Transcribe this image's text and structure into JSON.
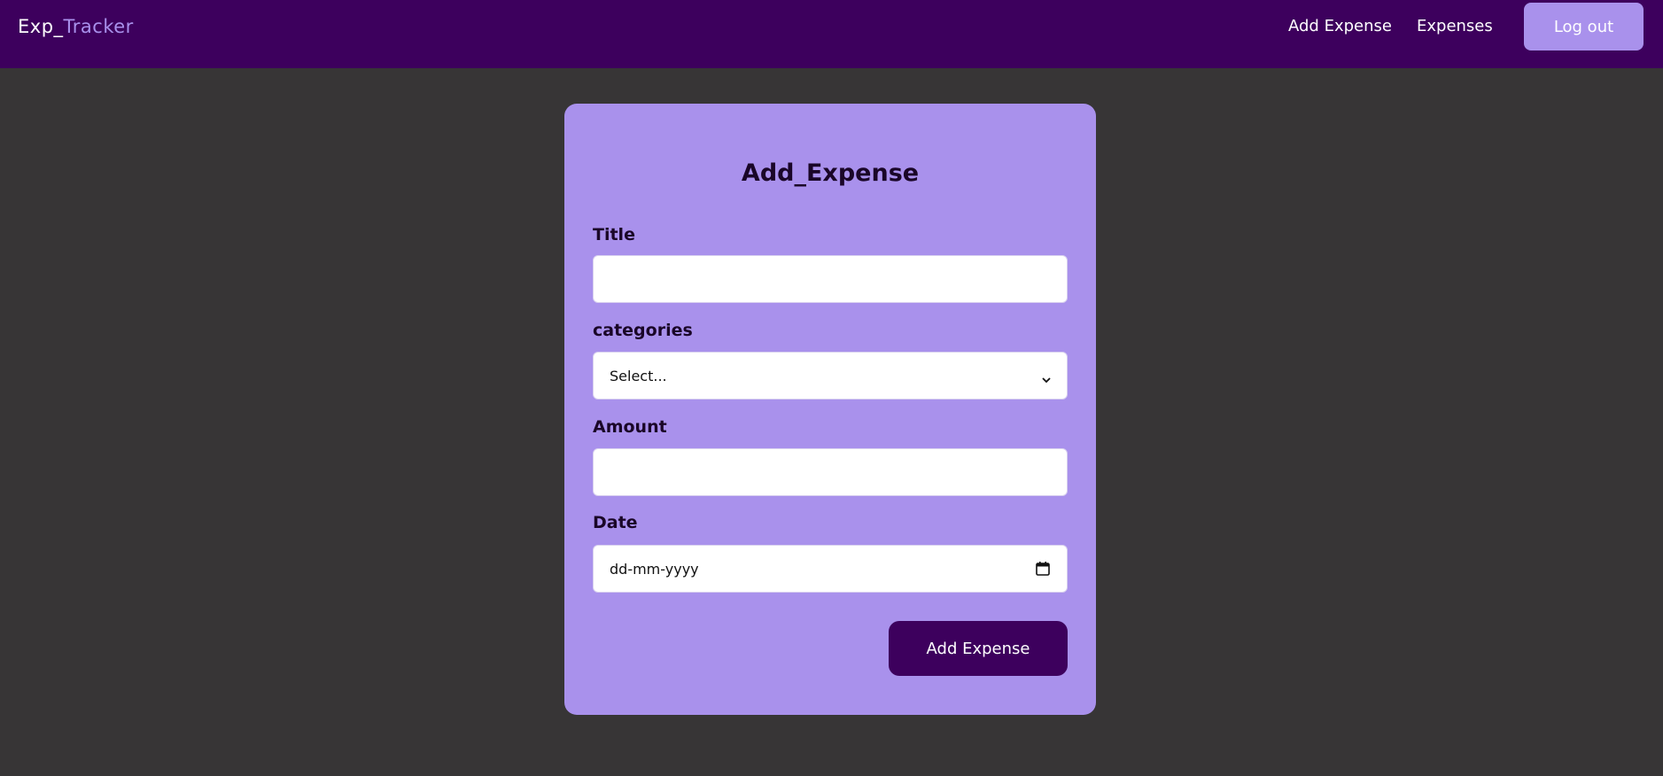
{
  "navbar": {
    "brand_prefix": "Exp_",
    "brand_accent": "Tracker",
    "links": [
      {
        "label": "Add Expense"
      },
      {
        "label": "Expenses"
      }
    ],
    "logout_label": "Log out"
  },
  "form": {
    "title": "Add_Expense",
    "fields": {
      "title": {
        "label": "Title",
        "value": ""
      },
      "categories": {
        "label": "categories",
        "selected": "Select..."
      },
      "amount": {
        "label": "Amount",
        "value": ""
      },
      "date": {
        "label": "Date",
        "placeholder": "dd-mm-yyyy"
      }
    },
    "submit_label": "Add Expense"
  },
  "icons": {
    "select": "chevron-down-icon",
    "date": "calendar-icon"
  },
  "colors": {
    "navbar_bg": "#3d005d",
    "accent": "#a991ec",
    "page_bg": "#373536",
    "card_bg": "#a991ec",
    "button_dark": "#3d005d"
  }
}
